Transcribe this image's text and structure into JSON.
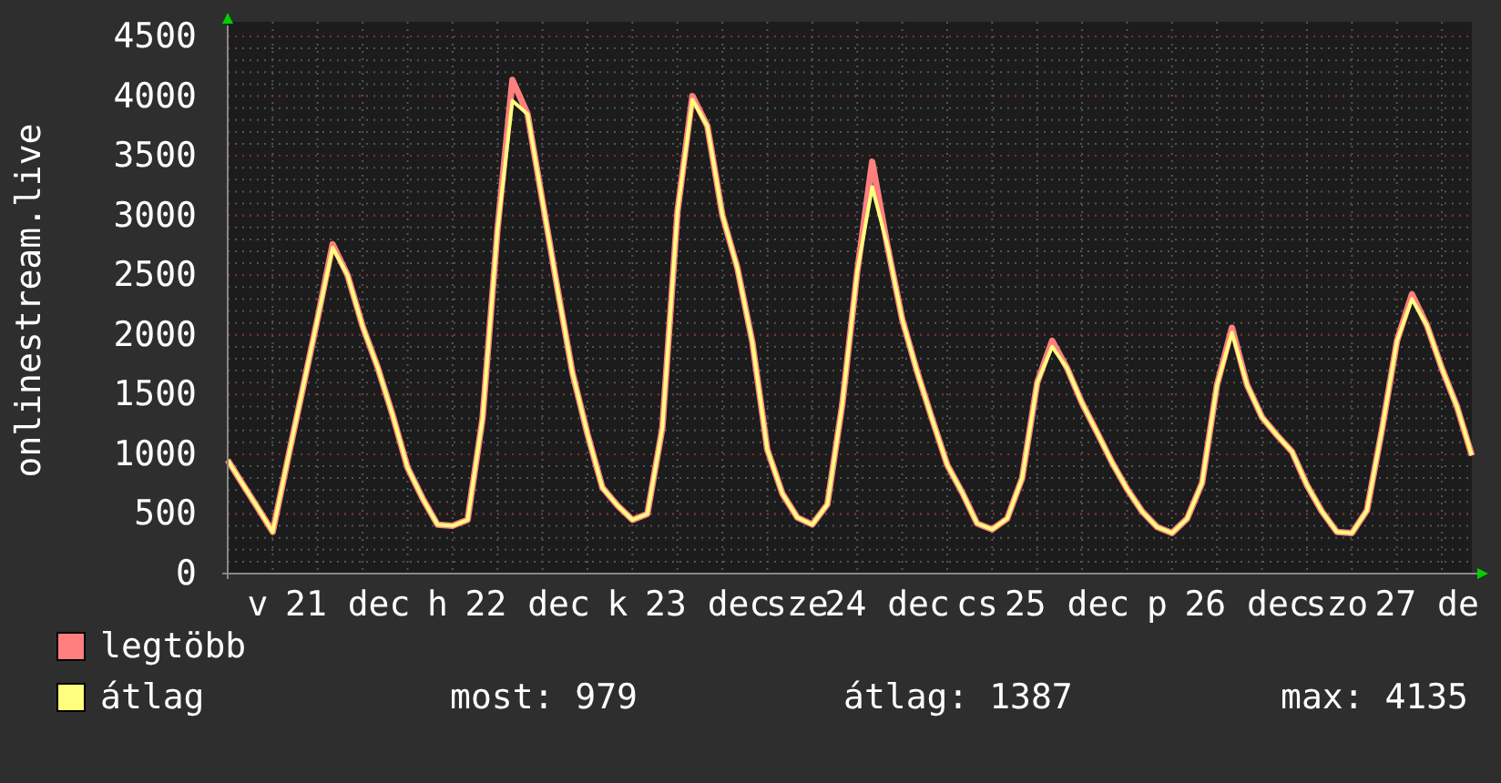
{
  "chart": {
    "chart_data": {
      "type": "line",
      "grid": true,
      "ylabel": "onlinestream.live",
      "ylim": [
        0,
        4500
      ],
      "yticks": [
        0,
        500,
        1000,
        1500,
        2000,
        2500,
        3000,
        3500,
        4000,
        4500
      ],
      "categories": [
        null,
        null,
        "v",
        null,
        null,
        null,
        null,
        null,
        "21 dec",
        null,
        null,
        null,
        null,
        null,
        "h",
        null,
        null,
        null,
        null,
        null,
        "22 dec",
        null,
        null,
        null,
        null,
        null,
        "k",
        null,
        null,
        null,
        null,
        null,
        "23 dec",
        null,
        null,
        null,
        null,
        null,
        "sze",
        null,
        null,
        null,
        null,
        null,
        "24 dec",
        null,
        null,
        null,
        null,
        null,
        "cs",
        null,
        null,
        null,
        null,
        null,
        "25 dec",
        null,
        null,
        null,
        null,
        null,
        "p",
        null,
        null,
        null,
        null,
        null,
        "26 dec",
        null,
        null,
        null,
        null,
        null,
        "szo",
        null,
        null,
        null,
        null,
        null,
        "27 de",
        null,
        null,
        null
      ],
      "series": [
        {
          "name": "legtöbb",
          "color": "#ff7f7f",
          "values": [
            950,
            750,
            550,
            350,
            950,
            1540,
            2140,
            2760,
            2500,
            2070,
            1730,
            1330,
            890,
            630,
            410,
            400,
            450,
            1300,
            2880,
            4135,
            3850,
            3120,
            2390,
            1680,
            1170,
            720,
            570,
            450,
            500,
            1220,
            3030,
            4000,
            3750,
            3000,
            2560,
            1940,
            1040,
            670,
            470,
            410,
            580,
            1420,
            2530,
            3450,
            2750,
            2130,
            1690,
            1290,
            910,
            680,
            420,
            370,
            460,
            800,
            1600,
            1950,
            1720,
            1430,
            1180,
            930,
            710,
            520,
            390,
            340,
            460,
            760,
            1580,
            2060,
            1580,
            1310,
            1160,
            1020,
            740,
            520,
            350,
            340,
            530,
            1200,
            1950,
            2340,
            2080,
            1720,
            1400,
            990
          ]
        },
        {
          "name": "átlag",
          "color": "#ffff7f",
          "values": [
            950,
            750,
            550,
            350,
            950,
            1540,
            2140,
            2730,
            2500,
            2070,
            1730,
            1330,
            890,
            630,
            410,
            400,
            450,
            1300,
            2880,
            3960,
            3850,
            3120,
            2390,
            1680,
            1170,
            720,
            570,
            450,
            500,
            1220,
            3030,
            3970,
            3750,
            3000,
            2560,
            1940,
            1040,
            670,
            470,
            410,
            580,
            1420,
            2530,
            3240,
            2750,
            2130,
            1690,
            1290,
            910,
            680,
            420,
            370,
            460,
            800,
            1600,
            1900,
            1720,
            1430,
            1180,
            930,
            710,
            520,
            390,
            340,
            460,
            760,
            1580,
            2020,
            1580,
            1310,
            1160,
            1020,
            740,
            520,
            350,
            340,
            530,
            1200,
            1950,
            2300,
            2080,
            1720,
            1400,
            990
          ]
        }
      ]
    },
    "stats": [
      "most: 979",
      "átlag: 1387",
      "max: 4135"
    ]
  }
}
